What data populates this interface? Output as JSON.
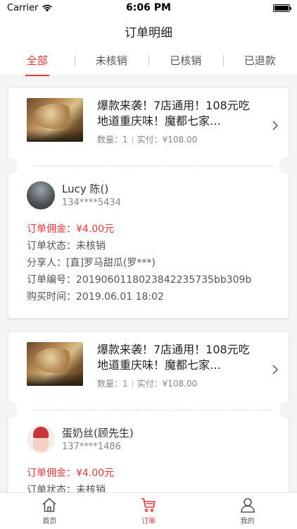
{
  "status_bar": {
    "carrier": "Carrier",
    "time": "6:06 PM"
  },
  "nav": {
    "title": "订单明细"
  },
  "tabs": [
    {
      "label": "全部",
      "active": true
    },
    {
      "label": "未核销",
      "active": false
    },
    {
      "label": "已核销",
      "active": false
    },
    {
      "label": "已退款",
      "active": false
    }
  ],
  "orders": [
    {
      "title": "爆款来袭！7店通用！108元吃地道重庆味！魔都七家…",
      "qty": "数量：1",
      "paid": "实付：¥108.00",
      "user_name": "Lucy  陈()",
      "user_phone": "134****5434",
      "commission": "订单佣金：¥4.00元",
      "status": "订单状态：未核销",
      "sharer": "分享人：[直]罗马甜瓜(罗***)",
      "order_no": "订单编号：2019060118023842235735bb309b",
      "purchase_time": "购买时间：2019.06.01 18:02"
    },
    {
      "title": "爆款来袭！7店通用！108元吃地道重庆味！魔都七家…",
      "qty": "数量：1",
      "paid": "实付：¥108.00",
      "user_name": "蛋奶丝(顾先生)",
      "user_phone": "137****1486",
      "commission": "订单佣金：¥4.00元",
      "status": "订单状态：未核销"
    }
  ],
  "tab_bar": [
    {
      "label": "首页",
      "icon": "home-icon",
      "active": false
    },
    {
      "label": "订单",
      "icon": "cart-icon",
      "active": true
    },
    {
      "label": "我的",
      "icon": "user-icon",
      "active": false
    }
  ],
  "colors": {
    "accent": "#e8383d",
    "background": "#f4f4f4"
  }
}
